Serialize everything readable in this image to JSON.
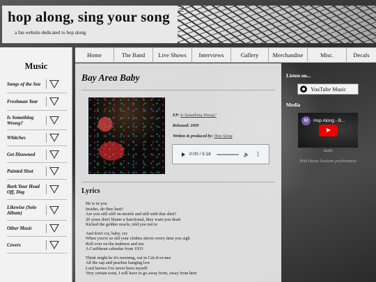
{
  "site": {
    "title": "hop along, sing your song",
    "tagline": "a fan website dedicated to hop along"
  },
  "nav": {
    "items": [
      "Home",
      "The Band",
      "Live Shows",
      "Interviews",
      "Gallery",
      "Merchandise",
      "Misc.",
      "Decals"
    ]
  },
  "sidebar": {
    "title": "Music",
    "items": [
      "Songs of the Sea",
      "Freshman Year",
      "Is Something Wrong?",
      "Whitches",
      "Get Disowned",
      "Painted Shut",
      "Bark Your Head Off, Dog",
      "Likewise (Solo Album)",
      "Other Music",
      "Covers"
    ]
  },
  "song": {
    "title": "Bay Area Baby",
    "ep_label": "EP:",
    "ep_value": "Is Something Wrong?",
    "released_label": "Released:",
    "released_value": "2009",
    "written_label": "Written & produced by:",
    "written_value": "Hop Along"
  },
  "audio": {
    "time": "0:00 / 5:18",
    "volume_icon": "volume-icon",
    "play_icon": "play-icon"
  },
  "lyrics": {
    "heading": "Lyrics",
    "stanzas": [
      [
        "He is in you",
        "Insides, do they hurt?",
        "Are you still stiff on motels and still with that shirt?",
        "20 years don't blame a functional, they want you dead",
        "Kicked the golden oracle, told you not to"
      ],
      [
        "And don't cry, baby, cry",
        "When you're so old your clothes shiver every time you sigh",
        "Roll over on the mattress and see",
        "A Caribbean calendar from 1933"
      ],
      [
        "Think might be it's morning, out in Cal-if-or-nee",
        "All the sap and peaches hanging low",
        "Lord knows I've never been myself",
        "Very certain soon, I will have to go away from, away from here"
      ]
    ]
  },
  "right": {
    "listen_heading": "Listen on...",
    "youtube_music_label": "YouTube Music",
    "media_heading": "Media",
    "video_avatar_letter": "M",
    "video_title": "Hop Along - B...",
    "audio_caption": "Audio",
    "video_caption": "Pink House Sessions performance"
  },
  "colors": {
    "panel": "#e8e8e8",
    "accent_red": "#ee0000",
    "avatar": "#7b5ea7"
  }
}
